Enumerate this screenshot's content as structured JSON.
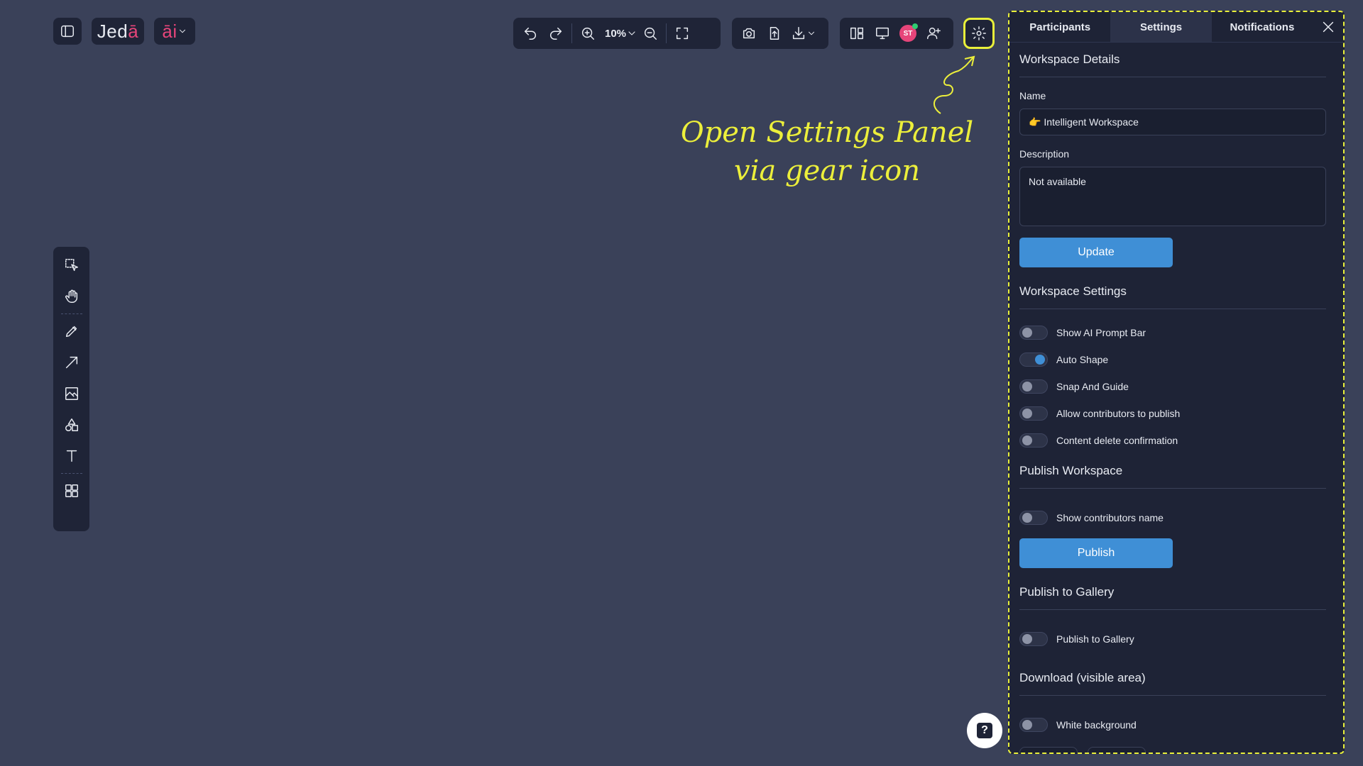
{
  "app": {
    "logo": {
      "text_main": "Jed",
      "text_accent": "ā"
    },
    "ai_badge": {
      "text_main": "",
      "text_accent": "āi"
    }
  },
  "toolbar": {
    "zoom_value": "10%",
    "avatar_initials": "ST"
  },
  "annotation": {
    "line1": "Open Settings Panel",
    "line2": "via gear icon"
  },
  "panel": {
    "tabs": [
      {
        "label": "Participants"
      },
      {
        "label": "Settings"
      },
      {
        "label": "Notifications"
      }
    ],
    "workspace_details": {
      "title": "Workspace Details",
      "name_label": "Name",
      "name_value": "👉 Intelligent Workspace",
      "description_label": "Description",
      "description_value": "Not available",
      "update_button": "Update"
    },
    "workspace_settings": {
      "title": "Workspace Settings",
      "toggles": [
        {
          "label": "Show AI Prompt Bar",
          "on": false
        },
        {
          "label": "Auto Shape",
          "on": true
        },
        {
          "label": "Snap And Guide",
          "on": false
        },
        {
          "label": "Allow contributors to publish",
          "on": false
        },
        {
          "label": "Content delete confirmation",
          "on": false
        }
      ]
    },
    "publish_workspace": {
      "title": "Publish Workspace",
      "toggle_label": "Show contributors name",
      "publish_button": "Publish"
    },
    "publish_gallery": {
      "title": "Publish to Gallery",
      "toggle_label": "Publish to Gallery"
    },
    "download": {
      "title": "Download (visible area)",
      "toggle_label": "White background"
    }
  },
  "colors": {
    "canvas": "#3a4159",
    "panel": "#1e2336",
    "accent_button": "#3f8fd6",
    "highlight": "#e9f03a",
    "brand_pink": "#e6457a"
  }
}
